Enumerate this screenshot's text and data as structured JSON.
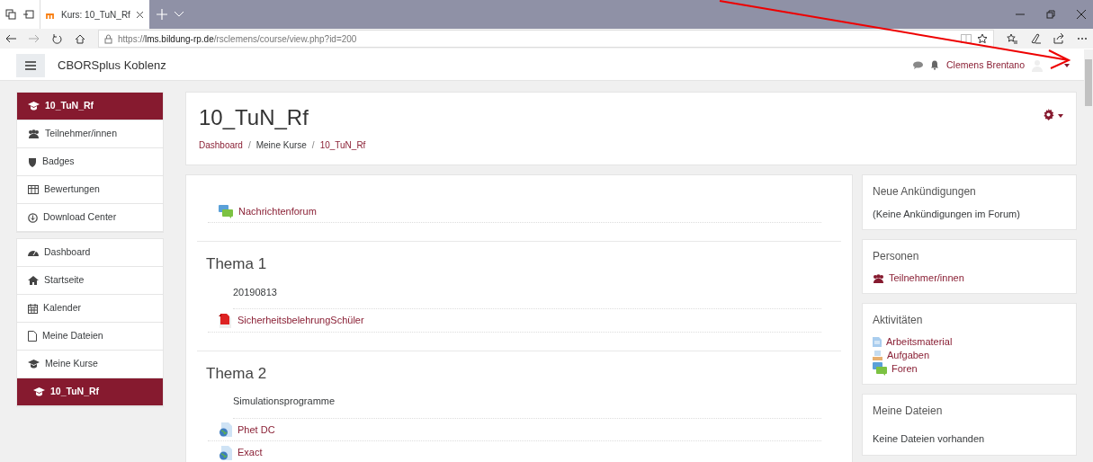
{
  "browser": {
    "tab_title": "Kurs: 10_TuN_Rf",
    "url": "https://**lms.bildung-rp.de**/rsclemens/course/view.php?id=200"
  },
  "navbar": {
    "site_name": "CBORSplus Koblenz",
    "user_name": "Clemens Brentano"
  },
  "sidebar": {
    "groups": [
      [
        {
          "label": "10_TuN_Rf",
          "selected": true
        },
        {
          "label": "Teilnehmer/innen",
          "selected": false
        },
        {
          "label": "Badges",
          "selected": false
        },
        {
          "label": "Bewertungen",
          "selected": false
        },
        {
          "label": "Download Center",
          "selected": false
        }
      ],
      [
        {
          "label": "Dashboard",
          "selected": false
        },
        {
          "label": "Startseite",
          "selected": false
        },
        {
          "label": "Kalender",
          "selected": false
        },
        {
          "label": "Meine Dateien",
          "selected": false
        },
        {
          "label": "Meine Kurse",
          "selected": false
        },
        {
          "label": "10_TuN_Rf",
          "selected": true
        }
      ]
    ]
  },
  "course": {
    "title": "10_TuN_Rf",
    "breadcrumb": [
      {
        "label": "Dashboard",
        "kind": "link"
      },
      {
        "label": "Meine Kurse",
        "kind": "plain",
        "separator": "/"
      },
      {
        "label": "10_TuN_Rf",
        "kind": "link",
        "separator": "/"
      }
    ]
  },
  "sections": [
    {
      "activities": [
        {
          "name": "Nachrichtenforum",
          "kind": "forum"
        }
      ]
    },
    {
      "title": "Thema 1",
      "summary": "20190813",
      "activities": [
        {
          "name": "SicherheitsbelehrungSchüler",
          "kind": "pdf"
        }
      ]
    },
    {
      "title": "Thema 2",
      "summary": "Simulationsprogramme",
      "activities": [
        {
          "name": "Phet DC",
          "kind": "url"
        },
        {
          "name": "Exact",
          "kind": "url"
        }
      ]
    }
  ],
  "blocks": [
    {
      "title": "Neue Ankündigungen",
      "text": "(Keine Ankündigungen im Forum)"
    },
    {
      "title": "Personen",
      "links": [
        {
          "label": "Teilnehmer/innen",
          "kind": "people"
        }
      ]
    },
    {
      "title": "Aktivitäten",
      "links": [
        {
          "label": "Arbeitsmaterial",
          "kind": "resource"
        },
        {
          "label": "Aufgaben",
          "kind": "assign"
        },
        {
          "label": "Foren",
          "kind": "forum"
        }
      ]
    },
    {
      "title": "Meine Dateien",
      "text": "Keine Dateien vorhanden"
    }
  ]
}
